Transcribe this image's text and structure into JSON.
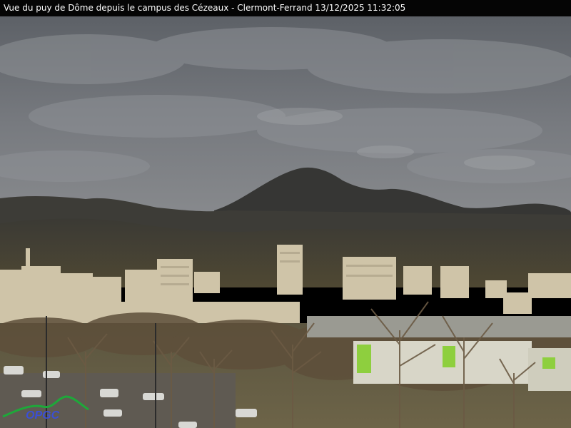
{
  "caption": {
    "text": "Vue du puy de Dôme depuis le campus des Cézeaux - Clermont-Ferrand 13/12/2025 11:32:05"
  },
  "scene": {
    "sky_color": "#6f7277",
    "cloud_color": "#8d9196",
    "mountain_color": "#3a3a38",
    "hills_color": "#4a4537",
    "city_color": "#cfc4a8",
    "trees_color": "#6e5e45",
    "grass_color": "#6e6a3e"
  },
  "logo": {
    "text": "OPGC",
    "color": "#3b4fd6",
    "swoosh_color": "#1ea83a"
  }
}
